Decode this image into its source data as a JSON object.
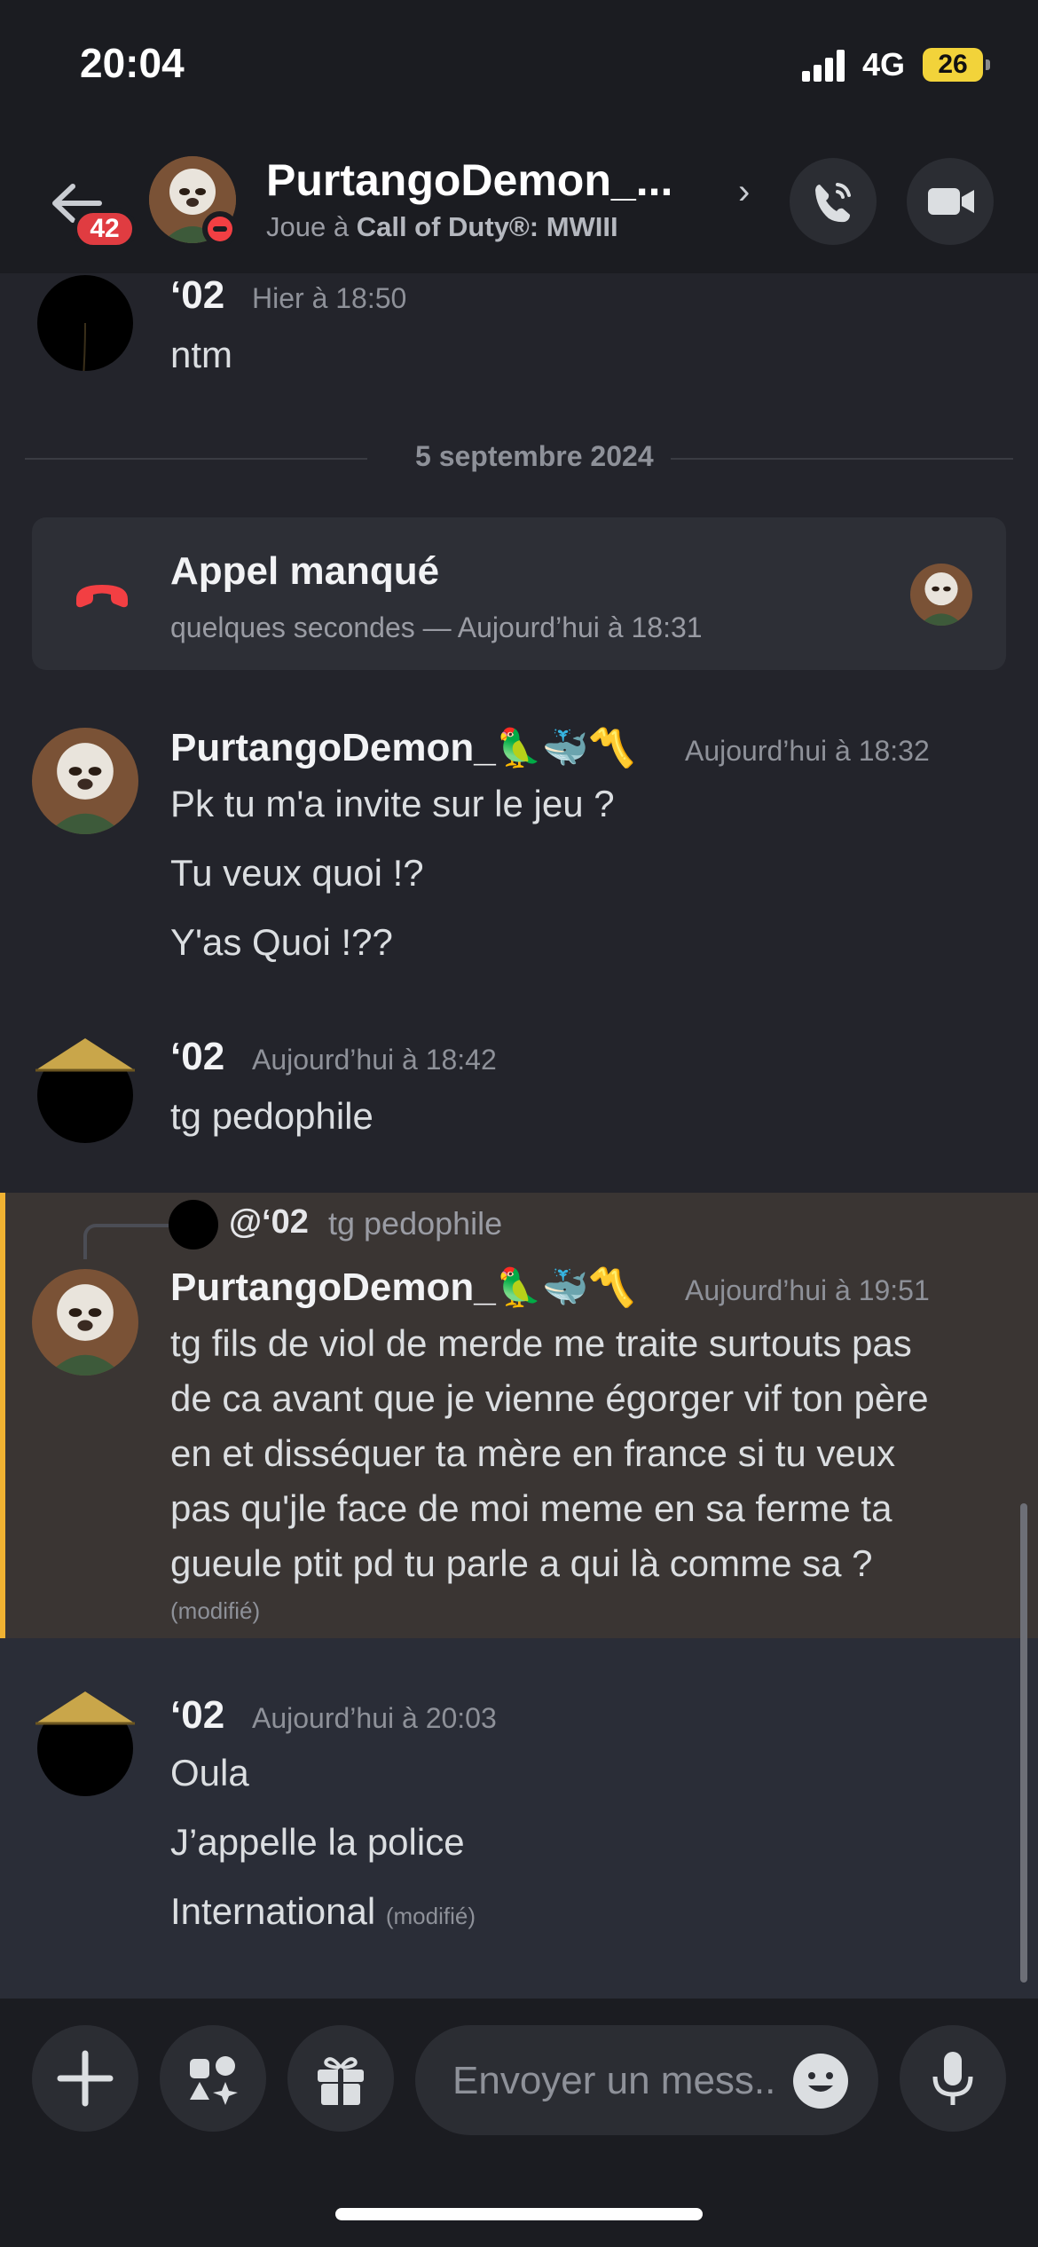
{
  "status_bar": {
    "time": "20:04",
    "network": "4G",
    "battery": "26"
  },
  "header": {
    "unread_badge": "42",
    "contact_name": "PurtangoDemon_...",
    "activity_prefix": "Joue à ",
    "activity_game": "Call of Duty®: MWIII",
    "chevron": "›"
  },
  "messages": {
    "m1": {
      "author": "‘02",
      "timestamp": "Hier à 18:50",
      "lines": [
        "ntm"
      ]
    },
    "date_separator": "5 septembre 2024",
    "missed_call": {
      "title": "Appel manqué",
      "subtitle": "quelques secondes — Aujourd’hui à 18:31"
    },
    "m2": {
      "author": "PurtangoDemon_",
      "badges": "🦜🐳〽️",
      "timestamp": "Aujourd’hui à 18:32",
      "lines": [
        "Pk tu m'a invite sur le jeu ?",
        "Tu veux quoi  !?",
        "Y'as Quoi !??"
      ]
    },
    "m3": {
      "author": "‘02",
      "timestamp": "Aujourd’hui à 18:42",
      "lines": [
        "tg pedophile"
      ]
    },
    "m4": {
      "reply_mention": "@‘02",
      "reply_text": "tg pedophile",
      "author": "PurtangoDemon_",
      "badges": "🦜🐳〽️",
      "timestamp": "Aujourd’hui à 19:51",
      "lines": [
        "tg fils de viol de merde me traite surtouts pas",
        "de ca avant que je vienne égorger vif ton père",
        "en et disséquer ta mère en france si tu veux",
        "pas qu'jle face de moi meme en sa ferme ta",
        "gueule ptit pd tu parle a qui là comme sa ?"
      ],
      "edited": "(modifié)"
    },
    "m5": {
      "author": "‘02",
      "timestamp": "Aujourd’hui à 20:03",
      "lines": [
        "Oula",
        "J’appelle la police",
        "International"
      ],
      "edited": "(modifié)"
    }
  },
  "composer": {
    "placeholder": "Envoyer un mess.."
  },
  "colors": {
    "background": "#23242b",
    "header_bg": "#1b1c21",
    "highlight_bg": "#3a3533",
    "highlight_bar": "#f0b232",
    "missed_call_red": "#f23f43",
    "badge_red": "#e03c41",
    "dnd_red": "#f23f43"
  },
  "icons": {
    "back": "arrow-left-icon",
    "call": "phone-icon",
    "video": "video-camera-icon",
    "missed_call": "phone-hangup-icon",
    "plus": "plus-icon",
    "apps": "apps-icon",
    "gift": "gift-icon",
    "emoji": "emoji-icon",
    "mic": "microphone-icon"
  }
}
